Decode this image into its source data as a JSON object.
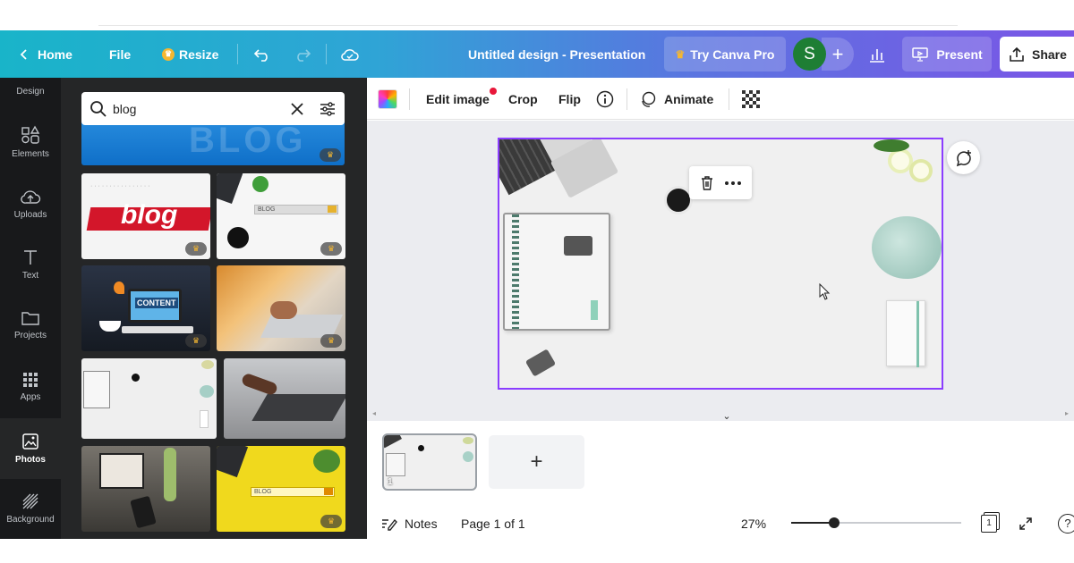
{
  "header": {
    "home_label": "Home",
    "file_label": "File",
    "resize_label": "Resize",
    "document_title": "Untitled design - Presentation",
    "try_pro_label": "Try Canva Pro",
    "avatar_initial": "S",
    "present_label": "Present",
    "share_label": "Share",
    "gradient_start": "#19b4c9",
    "gradient_end": "#7a55e6"
  },
  "rail": {
    "items": [
      {
        "label": "Design",
        "icon": "design-icon"
      },
      {
        "label": "Elements",
        "icon": "elements-icon"
      },
      {
        "label": "Uploads",
        "icon": "cloud-upload-icon"
      },
      {
        "label": "Text",
        "icon": "text-icon"
      },
      {
        "label": "Projects",
        "icon": "folder-icon"
      },
      {
        "label": "Apps",
        "icon": "grid-icon"
      },
      {
        "label": "Photos",
        "icon": "image-icon"
      },
      {
        "label": "Background",
        "icon": "hatch-icon"
      }
    ],
    "active": "Photos"
  },
  "panel": {
    "search_value": "blog",
    "thumb_texts": {
      "blog_word": "blog",
      "blog_search": "BLOG",
      "content_word": "CONTENT"
    }
  },
  "toolbar": {
    "edit_image_label": "Edit image",
    "crop_label": "Crop",
    "flip_label": "Flip",
    "animate_label": "Animate"
  },
  "footer": {
    "notes_label": "Notes",
    "page_indicator": "Page 1 of 1",
    "zoom_label": "27%",
    "zoom_fraction": 0.25,
    "page_count_badge": "1",
    "page_thumb_number": "1"
  },
  "colors": {
    "selection": "#8b3dff",
    "crown": "#f5b731",
    "rail_bg": "#18191b",
    "panel_bg": "#252627",
    "workspace_bg": "#ebecf0"
  }
}
